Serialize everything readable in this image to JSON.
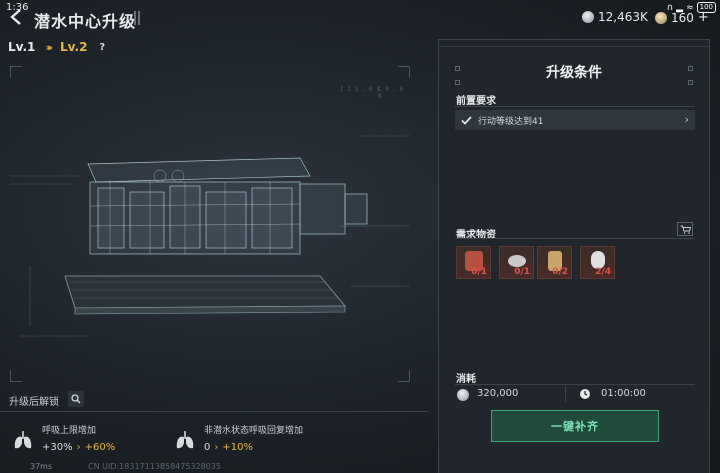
{
  "status_bar": {
    "time": "1:36",
    "battery": "100"
  },
  "header": {
    "title": "潜水中心升级"
  },
  "currencies": [
    {
      "icon": "silver-coin-icon",
      "value": "12,463K"
    },
    {
      "icon": "gold-coin-icon",
      "value": "160"
    }
  ],
  "level": {
    "from": "Lv.1",
    "arrows": "›››",
    "to": "Lv.2",
    "help": "?"
  },
  "hud": {
    "left_code": "[ 1 3 . 0 ]",
    "right_code": "C 0 . 0 8"
  },
  "unlock": {
    "title": "升级后解锁",
    "bonuses": [
      {
        "label": "呼吸上限增加",
        "old": "+30%",
        "arrow": "›",
        "new": "+60%"
      },
      {
        "label": "非潜水状态呼吸回复增加",
        "old": "0",
        "arrow": "›",
        "new": "+10%"
      }
    ]
  },
  "footer": {
    "ping": "37ms",
    "uid": "CN UID:18317113858475328035"
  },
  "panel": {
    "title": "升级条件",
    "prereq_title": "前置要求",
    "prereq_item": "行动等级达到41",
    "materials_title": "需求物资",
    "materials": [
      {
        "icon": "backpack-item-icon",
        "count": "0/1",
        "color": "#b5513e"
      },
      {
        "icon": "drone-item-icon",
        "count": "0/1",
        "color": "#c9c9c9"
      },
      {
        "icon": "lamp-item-icon",
        "count": "0/2",
        "color": "#c9a569"
      },
      {
        "icon": "mouse-item-icon",
        "count": "2/4",
        "color": "#e0e0e0"
      }
    ],
    "cost_title": "消耗",
    "cost_money": "320,000",
    "cost_time": "01:00:00",
    "fill_button": "一键补齐"
  },
  "colors": {
    "accent_gold": "#e7b748",
    "missing_red": "#e0524a",
    "button_green": "#3fa37a"
  }
}
